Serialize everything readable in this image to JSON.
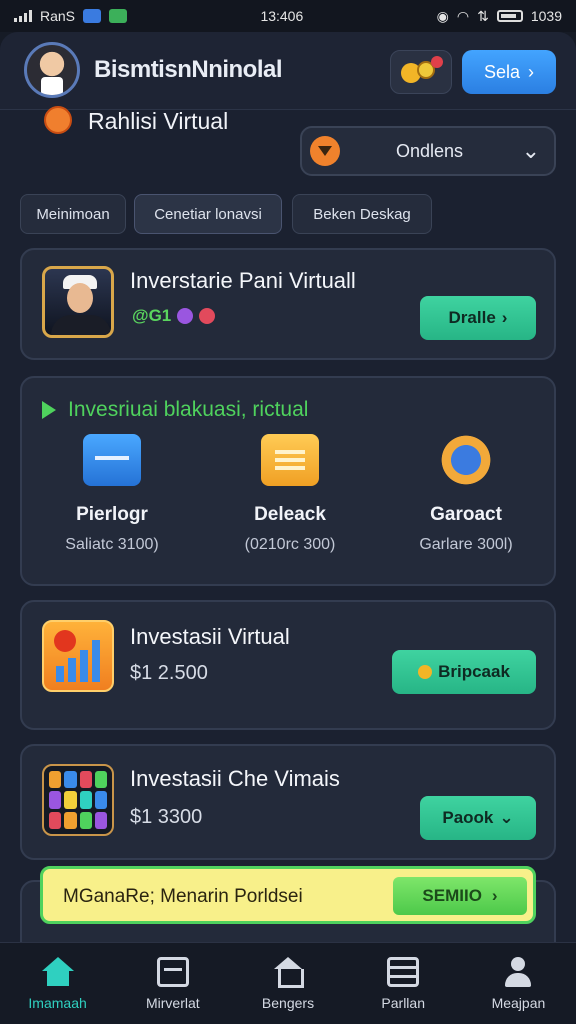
{
  "statusbar": {
    "carrier": "RanS",
    "time": "13:406",
    "right_text": "1039"
  },
  "header": {
    "username": "BismtisnNninolal",
    "top_button_label": "Sela",
    "top_button_chevron": "›"
  },
  "section": {
    "title": "Rahlisi Virtual"
  },
  "dropdown": {
    "label": "Ondlens",
    "chevron": "⌄"
  },
  "tabs": [
    {
      "label": "Meinimoan"
    },
    {
      "label": "Cenetiar lonavsi"
    },
    {
      "label": "Beken Deskag"
    }
  ],
  "featured": {
    "title": "Inverstarie Pani Virtuall",
    "tagline": "@G1",
    "button_label": "Dralle",
    "button_chevron": "›"
  },
  "overview": {
    "title": "Invesriuai blakuasi, rictual",
    "stats": [
      {
        "name": "Pierlogr",
        "value": "Saliatc 3100)",
        "icon": "calendar-icon"
      },
      {
        "name": "Deleack",
        "value": "(0210rc 300)",
        "icon": "document-icon"
      },
      {
        "name": "Garoact",
        "value": "Garlare 300l)",
        "icon": "gear-icon"
      }
    ]
  },
  "investments": [
    {
      "title": "Investasii Virtual",
      "price": "$1 2.500",
      "button_label": "Bripcaak"
    },
    {
      "title": "Investasii Che Vimais",
      "price": "$1 3300",
      "button_label": "Paook",
      "button_chevron": "⌄"
    }
  ],
  "promo": {
    "text": "MGanaRe; Menarin Porldsei",
    "button_label": "SEMIIO",
    "button_chevron": "›"
  },
  "nav": [
    {
      "label": "Imamaah"
    },
    {
      "label": "Mirverlat"
    },
    {
      "label": "Bengers"
    },
    {
      "label": "Parllan"
    },
    {
      "label": "Meajpan"
    }
  ],
  "colors": {
    "accent": "#2fd0c0",
    "green": "#4fd25d",
    "blue": "#3a95f5",
    "promo": "#f8f08a"
  }
}
